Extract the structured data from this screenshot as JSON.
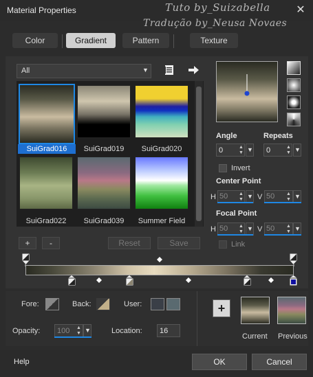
{
  "window": {
    "title": "Material Properties",
    "watermark_line1": "Tuto by_Suizabella",
    "watermark_line2": "Tradução by_Neusa Novaes"
  },
  "tabs": [
    {
      "label": "Color",
      "active": false
    },
    {
      "label": "Gradient",
      "active": true
    },
    {
      "label": "Pattern",
      "active": false
    },
    {
      "label": "Texture",
      "active": false
    }
  ],
  "gallery": {
    "filter_value": "All",
    "items": [
      {
        "label": "SuiGrad016",
        "selected": true
      },
      {
        "label": "SuiGrad019",
        "selected": false
      },
      {
        "label": "SuiGrad020",
        "selected": false
      },
      {
        "label": "SuiGrad022",
        "selected": false
      },
      {
        "label": "SuiGrad039",
        "selected": false
      },
      {
        "label": "Summer Field",
        "selected": false
      }
    ],
    "add_label": "+",
    "remove_label": "-",
    "reset_label": "Reset",
    "save_label": "Save"
  },
  "settings": {
    "angle_label": "Angle",
    "angle_value": "0",
    "repeats_label": "Repeats",
    "repeats_value": "0",
    "invert_label": "Invert",
    "center_point_label": "Center Point",
    "center_h_label": "H",
    "center_h_value": "50",
    "center_v_label": "V",
    "center_v_value": "50",
    "focal_point_label": "Focal Point",
    "focal_h_label": "H",
    "focal_h_value": "50",
    "focal_v_label": "V",
    "focal_v_value": "50",
    "link_label": "Link"
  },
  "stops": {
    "fore_label": "Fore:",
    "back_label": "Back:",
    "user_label": "User:",
    "opacity_label": "Opacity:",
    "opacity_value": "100",
    "location_label": "Location:",
    "location_value": "16"
  },
  "compare": {
    "current_label": "Current",
    "previous_label": "Previous",
    "plus_label": "+"
  },
  "footer": {
    "help_label": "Help",
    "ok_label": "OK",
    "cancel_label": "Cancel"
  },
  "colors": {
    "accent": "#1e88e5",
    "selected_label_bg": "#1e6fd0",
    "user_swatch_1": "#3a3f47",
    "user_swatch_2": "#5a6a70"
  }
}
